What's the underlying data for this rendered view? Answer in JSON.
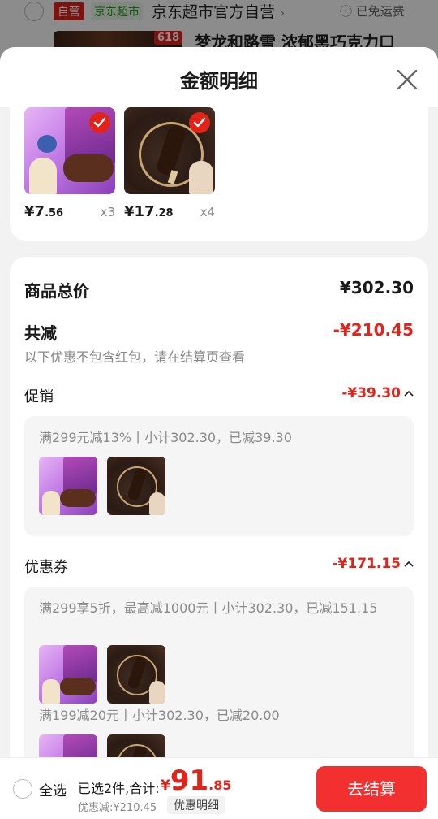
{
  "background": {
    "self_badge": "自营",
    "store_badge": "京东超市",
    "store_name": "京东超市官方自营",
    "store_chevron": "›",
    "free_shipping": "ⓘ 已免运费",
    "promo_badge": "618",
    "product_title": "梦龙和路雪 浓郁黑巧克力口"
  },
  "sheet": {
    "title": "金额明细",
    "close_icon": "close-icon"
  },
  "products": [
    {
      "price_int": "¥7",
      "price_dec": ".56",
      "qty": "x3",
      "image": "ice-cream-purple-box"
    },
    {
      "price_int": "¥17",
      "price_dec": ".28",
      "qty": "x4",
      "image": "ice-cream-dark-chocolate"
    }
  ],
  "summary": {
    "total_label": "商品总价",
    "total_value": "¥302.30",
    "discount_label": "共减",
    "discount_value": "-¥210.45",
    "discount_note": "以下优惠不包含红包，请在结算页查看"
  },
  "promotion": {
    "label": "促销",
    "value": "-¥39.30",
    "chevron": "^",
    "rule": "满299元减13%丨小计302.30，已减39.30"
  },
  "coupon": {
    "label": "优惠券",
    "value": "-¥171.15",
    "chevron": "^",
    "rule1": "满299享5折，最高减1000元丨小计302.30，已减151.15",
    "rule2": "满199减20元丨小计302.30，已减20.00"
  },
  "bottom_bar": {
    "select_all": "全选",
    "selected_count": "已选2件,合计:",
    "total_currency": "¥",
    "total_int": "91",
    "total_dec": ".85",
    "discount_line": "优惠减:¥210.45",
    "detail_button": "优惠明细",
    "checkout_button": "去结算"
  },
  "colors": {
    "accent_red": "#e2231a",
    "checkout_red": "#f23030"
  }
}
